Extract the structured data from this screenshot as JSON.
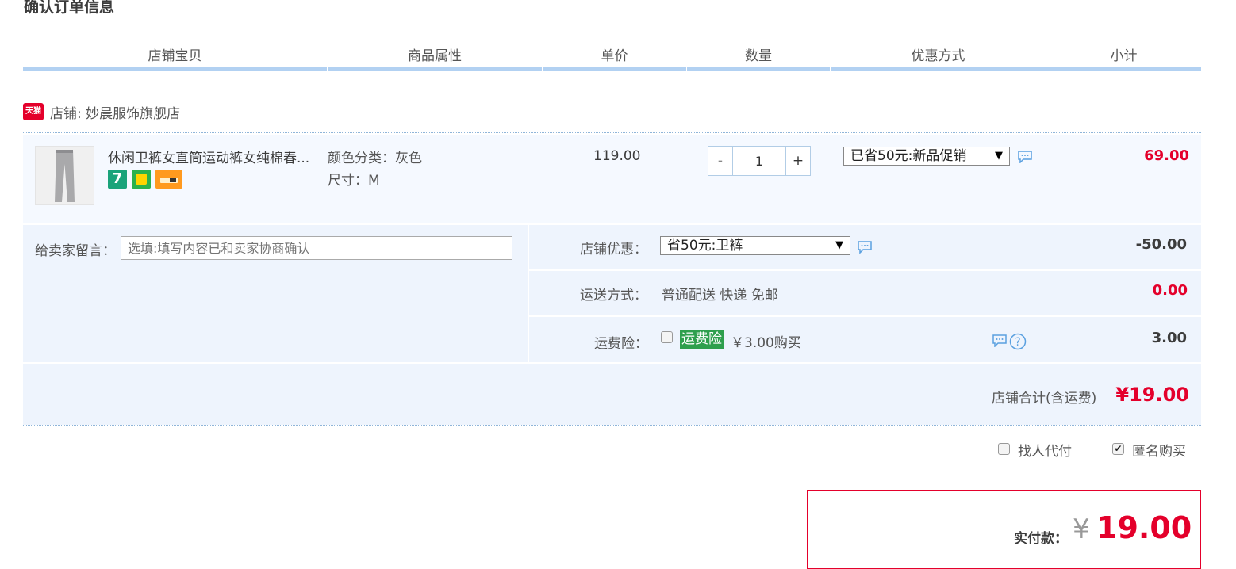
{
  "page_title": "确认订单信息",
  "columns": [
    "店铺宝贝",
    "商品属性",
    "单价",
    "数量",
    "优惠方式",
    "小计"
  ],
  "shop": {
    "icon_text": "天猫",
    "label": "店铺: 妙晨服饰旗舰店"
  },
  "item": {
    "title": "休闲卫裤女直筒运动裤女纯棉春...",
    "attr_color": "颜色分类：灰色",
    "attr_size": "尺寸：M",
    "unit_price": "119.00",
    "quantity": "1",
    "minus": "-",
    "plus": "+",
    "promo_select": "已省50元:新品促销",
    "subtotal": "69.00",
    "badges": [
      "7-day-return-badge",
      "bag-badge",
      "card-badge"
    ]
  },
  "memo": {
    "label": "给卖家留言：",
    "placeholder": "选填:填写内容已和卖家协商确认"
  },
  "shop_discount": {
    "label": "店铺优惠：",
    "select": "省50元:卫裤",
    "amount": "-50.00"
  },
  "shipping": {
    "label": "运送方式：",
    "value": "普通配送 快递 免邮",
    "amount": "0.00"
  },
  "insurance": {
    "label": "运费险：",
    "tag": "运费险",
    "value": "￥3.00购买",
    "amount": "3.00"
  },
  "shop_total": {
    "label": "店铺合计(含运费)",
    "amount": "¥19.00"
  },
  "options": {
    "proxy_pay": "找人代付",
    "anonymous": "匿名购买"
  },
  "payment": {
    "label": "实付款：",
    "currency": "¥",
    "amount": "19.00"
  },
  "colors": {
    "accent_red": "#e4002b",
    "header_bar": "#b2d1f2",
    "panel_bg": "#eef4fd",
    "insurance_green": "#2e9f4d"
  }
}
